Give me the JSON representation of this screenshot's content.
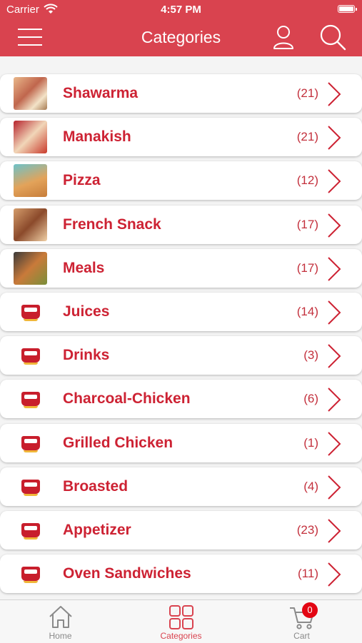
{
  "status_bar": {
    "carrier": "Carrier",
    "time": "4:57 PM"
  },
  "header": {
    "title": "Categories"
  },
  "categories": [
    {
      "name": "Shawarma",
      "count": "(21)",
      "thumb": "photo"
    },
    {
      "name": "Manakish",
      "count": "(21)",
      "thumb": "photo2"
    },
    {
      "name": "Pizza",
      "count": "(12)",
      "thumb": "photo3"
    },
    {
      "name": "French Snack",
      "count": "(17)",
      "thumb": "photo4"
    },
    {
      "name": "Meals",
      "count": "(17)",
      "thumb": "photo5"
    },
    {
      "name": "Juices",
      "count": "(14)",
      "thumb": "logo"
    },
    {
      "name": "Drinks",
      "count": "(3)",
      "thumb": "logo"
    },
    {
      "name": "Charcoal-Chicken",
      "count": "(6)",
      "thumb": "logo"
    },
    {
      "name": "Grilled Chicken",
      "count": "(1)",
      "thumb": "logo"
    },
    {
      "name": "Broasted",
      "count": "(4)",
      "thumb": "logo"
    },
    {
      "name": "Appetizer",
      "count": "(23)",
      "thumb": "logo"
    },
    {
      "name": "Oven Sandwiches",
      "count": "(11)",
      "thumb": "logo"
    }
  ],
  "tabs": [
    {
      "label": "Home",
      "icon": "home-icon"
    },
    {
      "label": "Categories",
      "icon": "categories-grid-icon"
    },
    {
      "label": "Cart",
      "icon": "cart-icon"
    }
  ],
  "cart_badge": "0",
  "colors": {
    "primary": "#d9434f",
    "category_text": "#cd2233",
    "badge": "#e30613"
  }
}
